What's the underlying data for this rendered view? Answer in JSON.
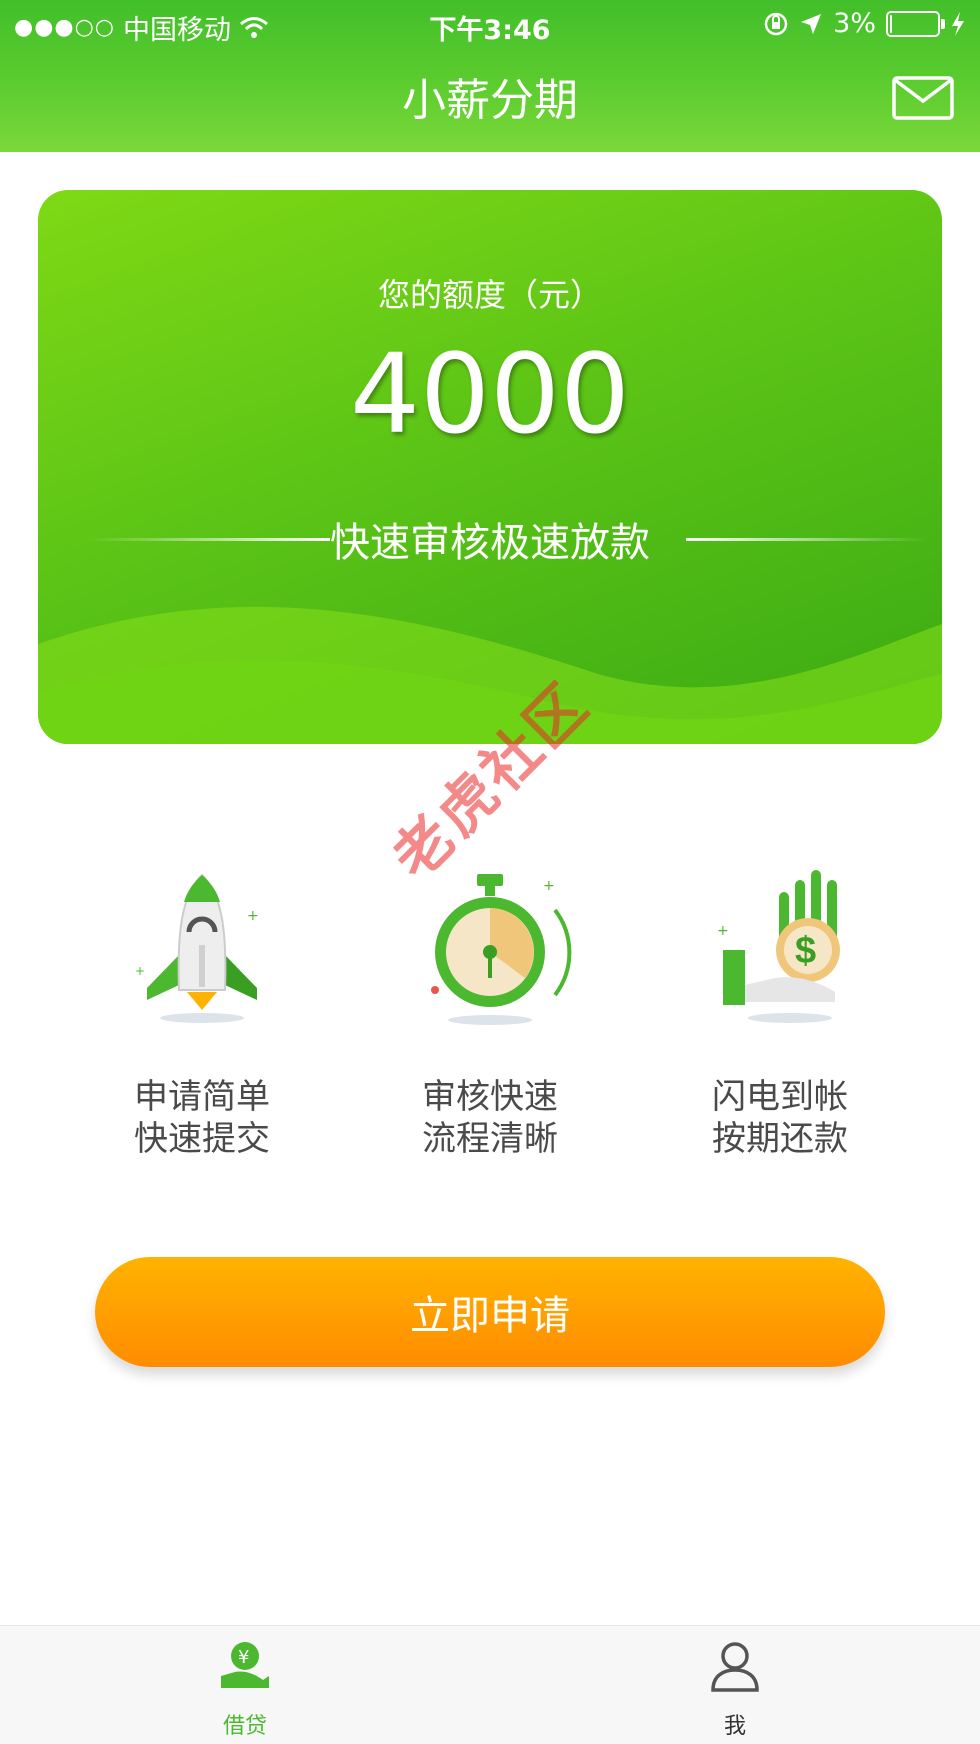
{
  "status_bar": {
    "signal_dots": "●●●○○",
    "carrier": "中国移动",
    "time": "下午3:46",
    "battery_percent": "3%",
    "battery_level": 0.03
  },
  "header": {
    "title": "小薪分期",
    "mail_icon": "mail-icon"
  },
  "card": {
    "label": "您的额度（元）",
    "amount": "4000",
    "slogan": "快速审核极速放款"
  },
  "watermark": "老虎社区",
  "features": [
    {
      "icon": "rocket-icon",
      "line1": "申请简单",
      "line2": "快速提交"
    },
    {
      "icon": "stopwatch-icon",
      "line1": "审核快速",
      "line2": "流程清晰"
    },
    {
      "icon": "money-hand-icon",
      "line1": "闪电到帐",
      "line2": "按期还款"
    }
  ],
  "apply_button": {
    "label": "立即申请"
  },
  "tabs": [
    {
      "label": "借贷",
      "icon": "loan-icon",
      "active": true
    },
    {
      "label": "我",
      "icon": "user-icon",
      "active": false
    }
  ],
  "colors": {
    "brand_green": "#4cc22e",
    "active_tab": "#4cb82f",
    "button_orange": "#ff9a00"
  }
}
